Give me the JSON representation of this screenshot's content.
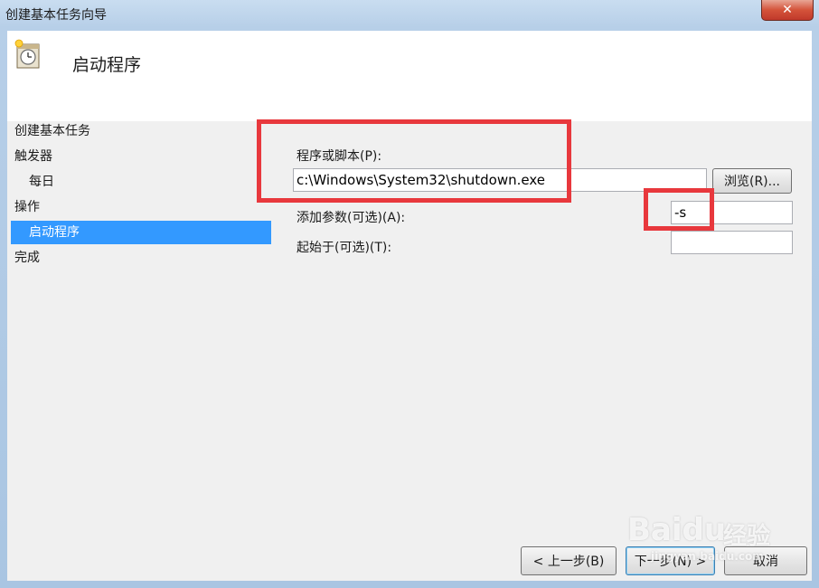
{
  "window": {
    "title": "创建基本任务向导",
    "close_glyph": "✕"
  },
  "header": {
    "title": "启动程序",
    "icon": "task-clock-icon"
  },
  "nav": {
    "items": [
      {
        "label": "创建基本任务",
        "selected": false
      },
      {
        "label": "触发器",
        "selected": false
      },
      {
        "label": "每日",
        "selected": false
      },
      {
        "label": "操作",
        "selected": false
      },
      {
        "label": "启动程序",
        "selected": true
      },
      {
        "label": "完成",
        "selected": false
      }
    ]
  },
  "form": {
    "program_label": "程序或脚本(P):",
    "program_value": "c:\\Windows\\System32\\shutdown.exe",
    "browse_label": "浏览(R)...",
    "args_label": "添加参数(可选)(A):",
    "args_value": "-s",
    "start_in_label": "起始于(可选)(T):",
    "start_in_value": ""
  },
  "footer": {
    "back_label": "< 上一步(B)",
    "next_label": "下一步(N) >",
    "cancel_label": "取消"
  },
  "watermark": {
    "brand": "Baidu",
    "product": "经验",
    "url": "jingyan.baidu.com"
  },
  "colors": {
    "highlight": "#e8383d",
    "selection": "#3399ff"
  }
}
